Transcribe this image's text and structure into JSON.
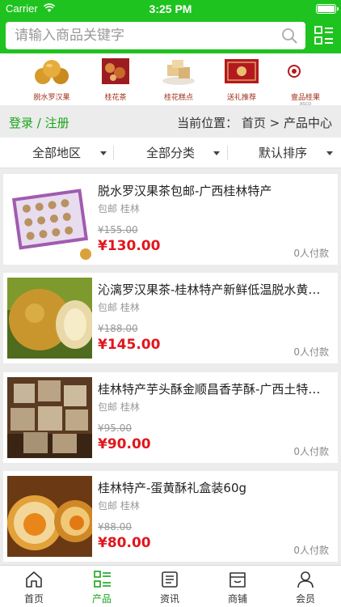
{
  "status": {
    "carrier": "Carrier",
    "time": "3:25 PM",
    "battery_level": 1.0
  },
  "search": {
    "placeholder": "请输入商品关键字",
    "value": ""
  },
  "banner": [
    {
      "title": "脱水罗汉果",
      "subtitle": "",
      "icon": "luohanguo-image"
    },
    {
      "title": "桂花茶",
      "subtitle": "",
      "icon": "osmanthus-tea-image"
    },
    {
      "title": "桂花糕点",
      "subtitle": "",
      "icon": "osmanthus-cake-image"
    },
    {
      "title": "送礼推荐",
      "subtitle": "",
      "icon": "gift-box-image"
    },
    {
      "title": "壹品桂果",
      "subtitle": "ASCO",
      "icon": "brand-logo-image"
    }
  ],
  "location_bar": {
    "login": "登录",
    "separator": "/",
    "register": "注册",
    "location": "当前位置： 首页 > 产品中心"
  },
  "filters": [
    {
      "label": "全部地区"
    },
    {
      "label": "全部分类"
    },
    {
      "label": "默认排序"
    }
  ],
  "products": [
    {
      "name": "脱水罗汉果茶包邮-广西桂林特产",
      "meta": "包邮 桂林",
      "old_price": "¥155.00",
      "price": "¥130.00",
      "paid": "0人付款"
    },
    {
      "name": "沁漓罗汉果茶-桂林特产新鲜低温脱水黄金罗汉果",
      "meta": "包邮 桂林",
      "old_price": "¥188.00",
      "price": "¥145.00",
      "paid": "0人付款"
    },
    {
      "name": "桂林特产芋头酥金顺昌香芋酥-广西土特产零食",
      "meta": "包邮 桂林",
      "old_price": "¥95.00",
      "price": "¥90.00",
      "paid": "0人付款"
    },
    {
      "name": "桂林特产-蛋黄酥礼盒装60g",
      "meta": "包邮 桂林",
      "old_price": "¥88.00",
      "price": "¥80.00",
      "paid": "0人付款"
    }
  ],
  "tabs": [
    {
      "label": "首页",
      "icon": "home-icon",
      "active": false
    },
    {
      "label": "产品",
      "icon": "products-icon",
      "active": true
    },
    {
      "label": "资讯",
      "icon": "news-icon",
      "active": false
    },
    {
      "label": "商铺",
      "icon": "store-icon",
      "active": false
    },
    {
      "label": "会员",
      "icon": "member-icon",
      "active": false
    }
  ],
  "colors": {
    "brand": "#1fc31f",
    "price": "#e1161d",
    "active_tab": "#1aa51a"
  }
}
